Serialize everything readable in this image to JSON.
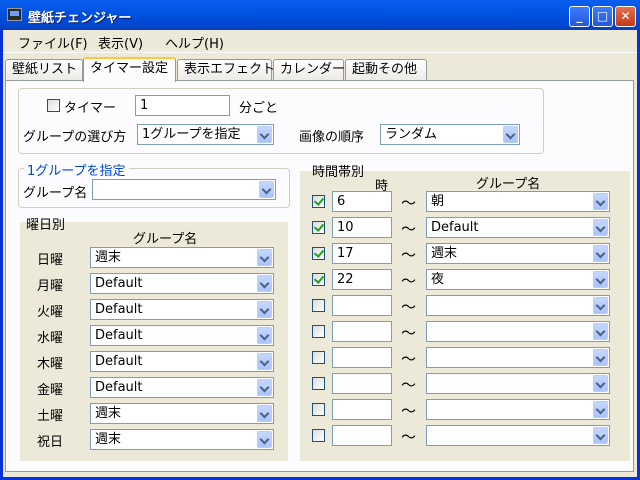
{
  "window": {
    "title": "壁紙チェンジャー"
  },
  "menu": [
    "ファイル(F)",
    "表示(V)",
    "ヘルプ(H)"
  ],
  "tabs": [
    "壁紙リスト",
    "タイマー設定",
    "表示エフェクト",
    "カレンダー",
    "起動その他"
  ],
  "active_tab": 1,
  "timer": {
    "checkbox_label": "タイマー",
    "checked": false,
    "interval_value": "1",
    "interval_unit": "分ごと",
    "group_method_label": "グループの選び方",
    "group_method_value": "1グループを指定",
    "image_order_label": "画像の順序",
    "image_order_value": "ランダム"
  },
  "single_group": {
    "caption": "1グループを指定",
    "group_name_label": "グループ名",
    "group_name_value": ""
  },
  "weekday": {
    "caption": "曜日別",
    "column_header": "グループ名",
    "rows": [
      {
        "day": "日曜",
        "group": "週末"
      },
      {
        "day": "月曜",
        "group": "Default"
      },
      {
        "day": "火曜",
        "group": "Default"
      },
      {
        "day": "水曜",
        "group": "Default"
      },
      {
        "day": "木曜",
        "group": "Default"
      },
      {
        "day": "金曜",
        "group": "Default"
      },
      {
        "day": "土曜",
        "group": "週末"
      },
      {
        "day": "祝日",
        "group": "週末"
      }
    ]
  },
  "timeslot": {
    "caption": "時間帯別",
    "hour_header": "時",
    "group_header": "グループ名",
    "tilde": "〜",
    "rows": [
      {
        "checked": true,
        "hour": "6",
        "group": "朝"
      },
      {
        "checked": true,
        "hour": "10",
        "group": "Default"
      },
      {
        "checked": true,
        "hour": "17",
        "group": "週末"
      },
      {
        "checked": true,
        "hour": "22",
        "group": "夜"
      },
      {
        "checked": false,
        "hour": "",
        "group": ""
      },
      {
        "checked": false,
        "hour": "",
        "group": ""
      },
      {
        "checked": false,
        "hour": "",
        "group": ""
      },
      {
        "checked": false,
        "hour": "",
        "group": ""
      },
      {
        "checked": false,
        "hour": "",
        "group": ""
      },
      {
        "checked": false,
        "hour": "",
        "group": ""
      }
    ]
  }
}
